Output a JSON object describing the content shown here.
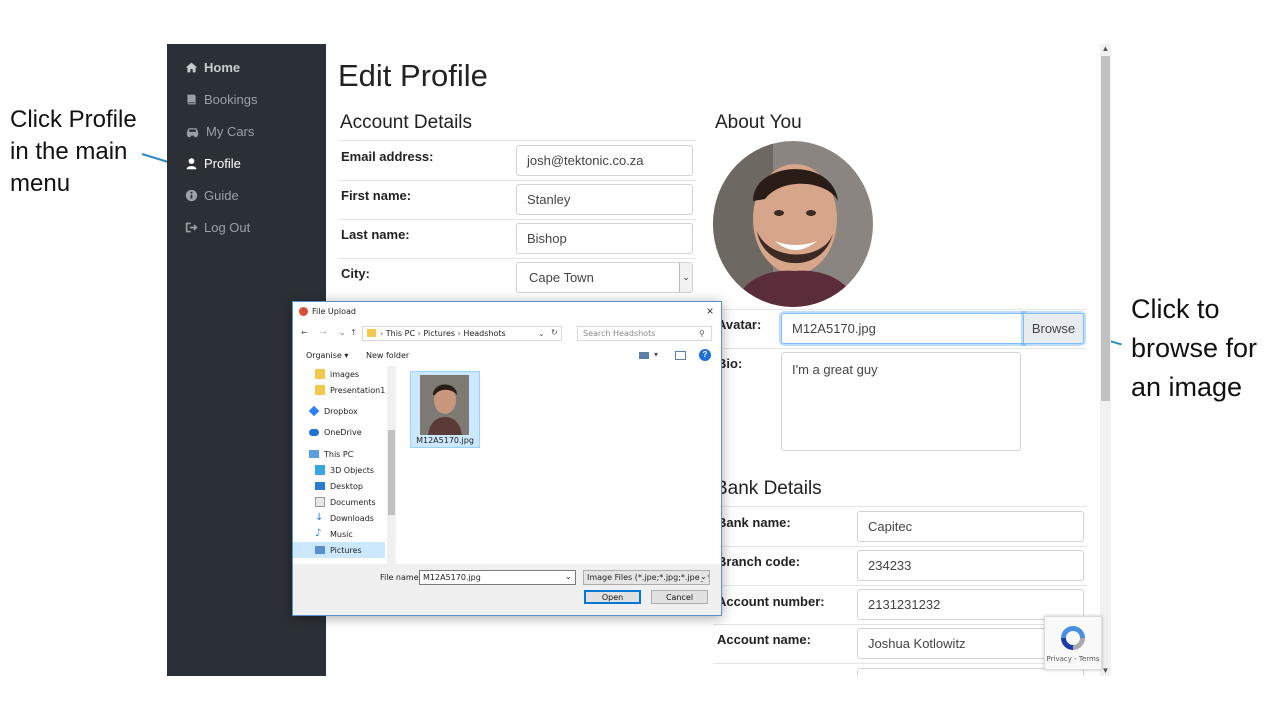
{
  "callouts": {
    "left": "Click Profile\nin the main\nmenu",
    "right": "Click to\nbrowse for\nan image"
  },
  "sidebar": {
    "items": [
      {
        "label": "Home",
        "icon": "home-icon"
      },
      {
        "label": "Bookings",
        "icon": "book-icon"
      },
      {
        "label": "My Cars",
        "icon": "car-icon"
      },
      {
        "label": "Profile",
        "icon": "user-icon"
      },
      {
        "label": "Guide",
        "icon": "info-icon"
      },
      {
        "label": "Log Out",
        "icon": "logout-icon"
      }
    ]
  },
  "page": {
    "title": "Edit Profile"
  },
  "account": {
    "heading": "Account Details",
    "email_label": "Email address:",
    "email_value": "josh@tektonic.co.za",
    "first_label": "First name:",
    "first_value": "Stanley",
    "last_label": "Last name:",
    "last_value": "Bishop",
    "city_label": "City:",
    "city_value": "Cape Town"
  },
  "about": {
    "heading": "About You",
    "avatar_label": "Avatar:",
    "avatar_value": "M12A5170.jpg",
    "browse_label": "Browse",
    "bio_label": "Bio:",
    "bio_value": "I'm a great guy"
  },
  "bank": {
    "heading": "Bank Details",
    "bank_name_label": "Bank name:",
    "bank_name_value": "Capitec",
    "branch_label": "Branch code:",
    "branch_value": "234233",
    "acc_num_label": "Account number:",
    "acc_num_value": "2131231232",
    "acc_name_label": "Account name:",
    "acc_name_value": "Joshua Kotlowitz"
  },
  "recaptcha": {
    "text": "Privacy - Terms"
  },
  "dialog": {
    "title": "File Upload",
    "path": [
      "This PC",
      "Pictures",
      "Headshots"
    ],
    "search_placeholder": "Search Headshots",
    "organise": "Organise",
    "new_folder": "New folder",
    "tree": [
      "images",
      "Presentation1",
      "Dropbox",
      "OneDrive",
      "This PC",
      "3D Objects",
      "Desktop",
      "Documents",
      "Downloads",
      "Music",
      "Pictures"
    ],
    "file_name_label": "File name:",
    "file_name_value": "M12A5170.jpg",
    "file_type_value": "Image Files (*.jpe;*.jpg;*.jpeg;*.",
    "file_item": "M12A5170.jpg",
    "open_label": "Open",
    "cancel_label": "Cancel"
  },
  "colors": {
    "sidebar_bg": "#2b3036",
    "callout_line": "#2e8bc0",
    "dialog_accent": "#5a8fd0"
  }
}
